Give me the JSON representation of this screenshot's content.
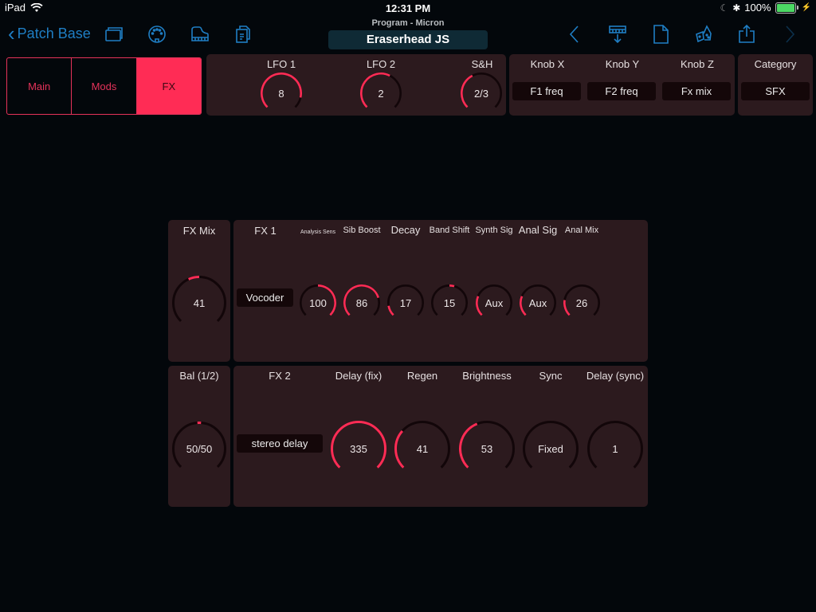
{
  "status_bar": {
    "device": "iPad",
    "time": "12:31 PM",
    "battery_percent": "100%",
    "battery_level": 1.0,
    "icons": [
      "wifi-icon",
      "moon-icon",
      "bluetooth-icon",
      "battery-icon",
      "charging-bolt-icon"
    ]
  },
  "nav": {
    "back_label": "Patch Base",
    "subtitle": "Program - Micron",
    "patch_name": "Eraserhead  JS",
    "left_icons": [
      "folders-icon",
      "midi-port-icon",
      "piano-icon",
      "copy-documents-icon"
    ],
    "right_icons": [
      "previous-chevron-icon",
      "send-to-device-icon",
      "new-document-icon",
      "randomize-dice-icon",
      "share-icon",
      "next-chevron-icon"
    ]
  },
  "tabs": [
    {
      "label": "Main",
      "active": false
    },
    {
      "label": "Mods",
      "active": false
    },
    {
      "label": "FX",
      "active": true
    }
  ],
  "lfo_panel": {
    "knobs": [
      {
        "label": "LFO 1",
        "value": "8",
        "fill": 0.88,
        "mode": "unipolar"
      },
      {
        "label": "LFO 2",
        "value": "2",
        "fill": 0.6,
        "mode": "unipolar"
      },
      {
        "label": "S&H",
        "value": "2/3",
        "fill": 0.4,
        "mode": "unipolar"
      }
    ]
  },
  "knob_assign": {
    "items": [
      {
        "label": "Knob X",
        "value": "F1 freq"
      },
      {
        "label": "Knob Y",
        "value": "F2 freq"
      },
      {
        "label": "Knob Z",
        "value": "Fx mix"
      }
    ]
  },
  "category": {
    "label": "Category",
    "value": "SFX"
  },
  "fx_mix": {
    "label": "FX Mix",
    "value": "41",
    "fill": 0.41,
    "mode": "bipolar"
  },
  "balance": {
    "label": "Bal (1/2)",
    "value": "50/50",
    "fill": 0.5,
    "mode": "bipolar"
  },
  "fx1": {
    "label": "FX 1",
    "type": "Vocoder",
    "knobs": [
      {
        "label": "Analysis Sens",
        "size": "tiny",
        "value": "100",
        "fill": 1.0,
        "mode": "bipolar"
      },
      {
        "label": "Sib Boost",
        "size": "small",
        "value": "86",
        "fill": 0.77,
        "mode": "unipolar"
      },
      {
        "label": "Decay",
        "size": "normal",
        "value": "17",
        "fill": 0.13,
        "mode": "unipolar"
      },
      {
        "label": "Band Shift",
        "size": "small",
        "value": "15",
        "fill": 0.56,
        "mode": "bipolar"
      },
      {
        "label": "Synth Sig",
        "size": "small",
        "value": "Aux",
        "fill": 0.25,
        "mode": "unipolar"
      },
      {
        "label": "Anal Sig",
        "size": "normal",
        "value": "Aux",
        "fill": 0.25,
        "mode": "unipolar"
      },
      {
        "label": "Anal Mix",
        "size": "small",
        "value": "26",
        "fill": 0.2,
        "mode": "unipolar"
      }
    ]
  },
  "fx2": {
    "label": "FX 2",
    "type": "stereo delay",
    "knobs": [
      {
        "label": "Delay (fix)",
        "value": "335",
        "fill": 1.0,
        "mode": "unipolar"
      },
      {
        "label": "Regen",
        "value": "41",
        "fill": 0.32,
        "mode": "unipolar"
      },
      {
        "label": "Brightness",
        "value": "53",
        "fill": 0.42,
        "mode": "unipolar"
      },
      {
        "label": "Sync",
        "value": "Fixed",
        "fill": 0.0,
        "mode": "unipolar"
      },
      {
        "label": "Delay (sync)",
        "value": "1",
        "fill": 0.0,
        "mode": "unipolar"
      }
    ]
  },
  "colors": {
    "accent": "#ff2c55",
    "track": "#120609",
    "panel": "#2c1a1e",
    "nav_blue": "#1f7ec4"
  }
}
